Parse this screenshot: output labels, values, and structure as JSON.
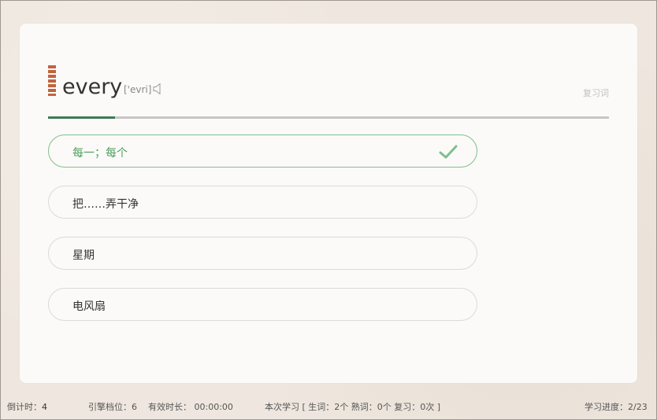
{
  "word": {
    "text": "every",
    "phonetic": "['evri]",
    "review_tag": "复习词"
  },
  "progress": {
    "fraction": 0.12
  },
  "options": [
    {
      "label": "每一；每个",
      "state": "correct"
    },
    {
      "label": "把……弄干净",
      "state": "normal"
    },
    {
      "label": "星期",
      "state": "normal"
    },
    {
      "label": "电风扇",
      "state": "normal"
    }
  ],
  "status": {
    "countdown_label": "倒计时：",
    "countdown_value": "4",
    "engine_level": "引擎档位：6",
    "effective_time": "有效时长： 00:00:00",
    "session_summary": "本次学习 [ 生词：2个 熟词：0个 复习：0次 ]",
    "progress": "学习进度：2/23"
  },
  "icons": {
    "speaker": "speaker-icon",
    "check": "check-icon"
  },
  "colors": {
    "accent_green": "#4aa05f",
    "progress_green": "#3d7a55",
    "word_marker": "#c0643e"
  }
}
